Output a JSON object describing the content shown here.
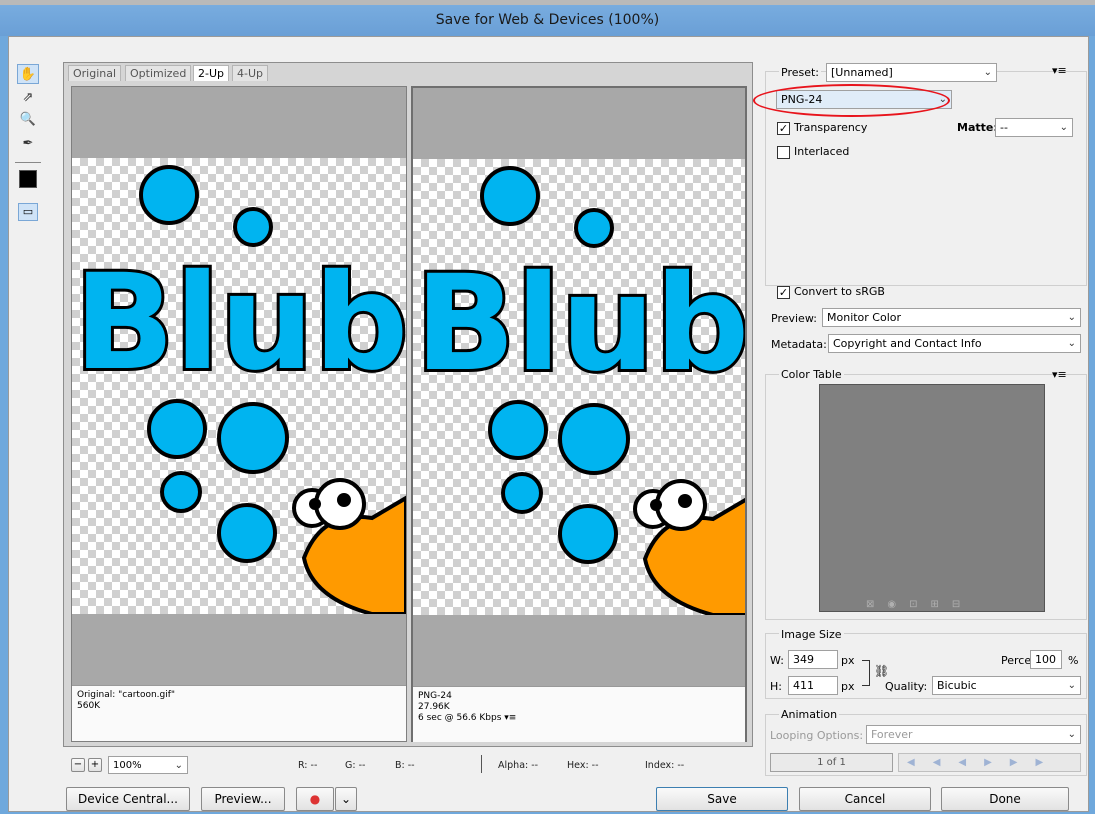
{
  "window": {
    "title": "Save for Web & Devices (100%)"
  },
  "tools": [
    {
      "icon": "hand-icon",
      "glyph": "✋"
    },
    {
      "icon": "slice-select-icon",
      "glyph": "⇗"
    },
    {
      "icon": "zoom-icon",
      "glyph": "🔍"
    },
    {
      "icon": "eyedropper-icon",
      "glyph": "✒"
    }
  ],
  "tabs": [
    {
      "label": "Original"
    },
    {
      "label": "Optimized"
    },
    {
      "label": "2-Up"
    },
    {
      "label": "4-Up"
    }
  ],
  "preview": {
    "artwork_text": "Blub",
    "left": {
      "line1": "Original: \"cartoon.gif\"",
      "line2": "560K"
    },
    "right": {
      "line1": "PNG-24",
      "line2": "27.96K",
      "line3": "6 sec @ 56.6 Kbps",
      "menu_glyph": "▾≡"
    }
  },
  "statusbar": {
    "zoom": "100%",
    "r": "R: --",
    "g": "G: --",
    "b": "B: --",
    "alpha": "Alpha: --",
    "hex": "Hex: --",
    "index": "Index: --"
  },
  "buttons": {
    "device_central": "Device Central...",
    "preview": "Preview...",
    "save": "Save",
    "cancel": "Cancel",
    "done": "Done"
  },
  "settings": {
    "preset_label": "Preset:",
    "preset_value": "[Unnamed]",
    "format": "PNG-24",
    "transparency": "Transparency",
    "transparency_checked": true,
    "matte_label": "Matte:",
    "matte_value": "--",
    "interlaced": "Interlaced",
    "interlaced_checked": false,
    "convert_srgb": "Convert to sRGB",
    "convert_checked": true,
    "preview_label": "Preview:",
    "preview_value": "Monitor Color",
    "metadata_label": "Metadata:",
    "metadata_value": "Copyright and Contact Info",
    "color_table_label": "Color Table"
  },
  "image_size": {
    "label": "Image Size",
    "w_label": "W:",
    "w": "349",
    "h_label": "H:",
    "h": "411",
    "unit": "px",
    "percent_label": "Percent:",
    "percent": "100",
    "percent_unit": "%",
    "quality_label": "Quality:",
    "quality": "Bicubic"
  },
  "animation": {
    "label": "Animation",
    "looping_label": "Looping Options:",
    "looping_value": "Forever",
    "frame": "1 of 1"
  },
  "colors": {
    "accent": "#3c7fb1",
    "highlight": "#e8141c",
    "bubble": "#00b4f0",
    "fish": "#ff9a00"
  }
}
